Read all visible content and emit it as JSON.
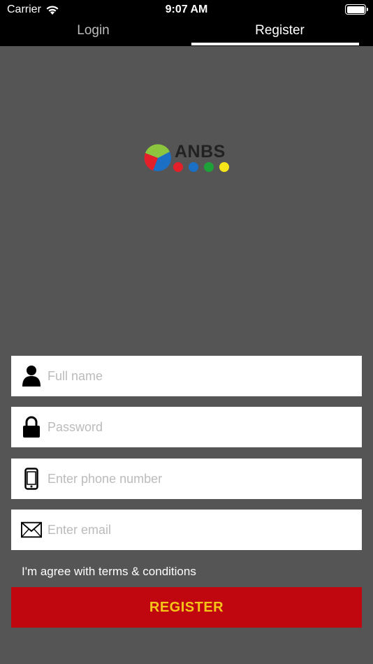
{
  "status_bar": {
    "carrier": "Carrier",
    "time": "9:07 AM"
  },
  "tabs": [
    {
      "label": "Login",
      "active": false
    },
    {
      "label": "Register",
      "active": true
    }
  ],
  "logo": {
    "text": "ANBS",
    "dot_colors": [
      "#e3202a",
      "#1b6fc4",
      "#1fa13a",
      "#f6e619"
    ]
  },
  "form": {
    "full_name": {
      "placeholder": "Full name",
      "value": "",
      "icon": "person-icon"
    },
    "password": {
      "placeholder": "Password",
      "value": "",
      "icon": "lock-icon"
    },
    "phone": {
      "placeholder": "Enter phone number",
      "value": "",
      "icon": "phone-icon"
    },
    "email": {
      "placeholder": "Enter email",
      "value": "",
      "icon": "mail-icon"
    }
  },
  "terms_text": "I'm agree with terms & conditions",
  "register_button_label": "REGISTER",
  "colors": {
    "background": "#555555",
    "button": "#c0070f",
    "button_text": "#f5c518"
  }
}
